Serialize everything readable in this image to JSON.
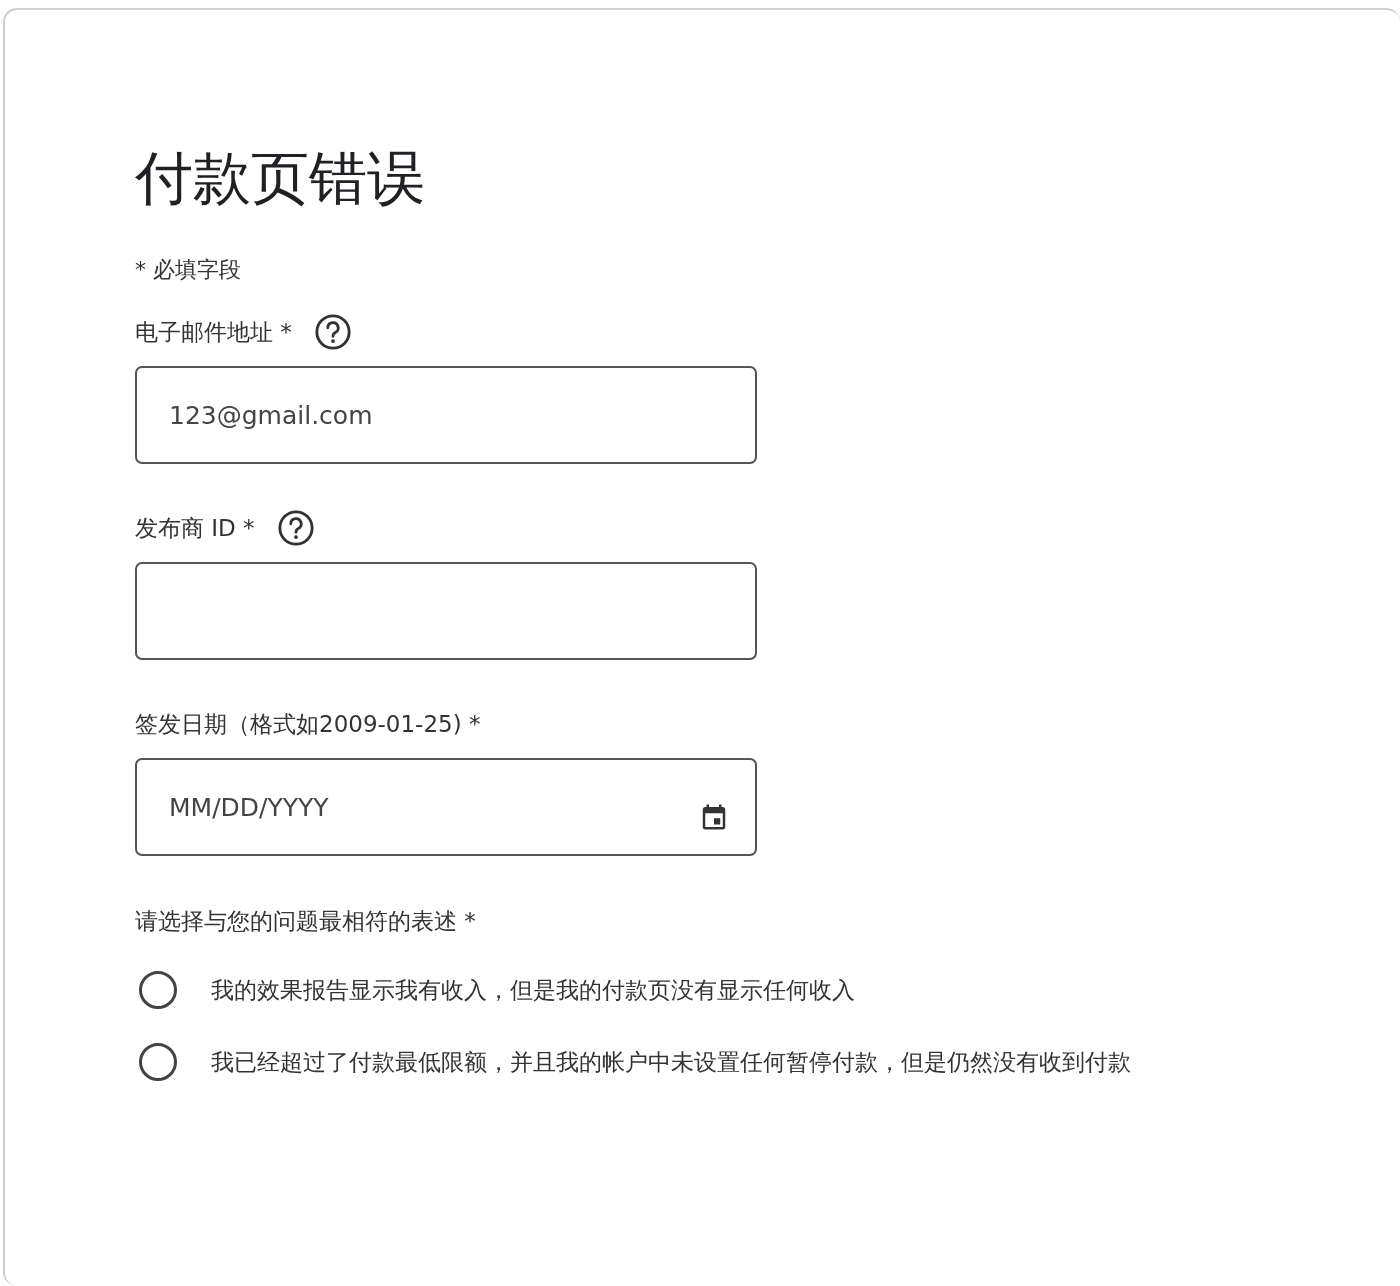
{
  "title": "付款页错误",
  "required_note": "* 必填字段",
  "fields": [
    {
      "kind": "text",
      "label": "电子邮件地址 *",
      "help": true,
      "value": "123@gmail.com"
    },
    {
      "kind": "text",
      "label": "发布商 ID *",
      "help": true
    },
    {
      "kind": "date",
      "label": "签发日期（格式如2009-01-25) *",
      "placeholder": "MM/DD/YYYY"
    }
  ],
  "question": {
    "label": "请选择与您的问题最相符的表述 *",
    "options": [
      {
        "label": "我的效果报告显示我有收入，但是我的付款页没有显示任何收入",
        "selected": false
      },
      {
        "label": "我已经超过了付款最低限额，并且我的帐户中未设置任何暂停付款，但是仍然没有收到付款",
        "selected": false
      }
    ]
  }
}
